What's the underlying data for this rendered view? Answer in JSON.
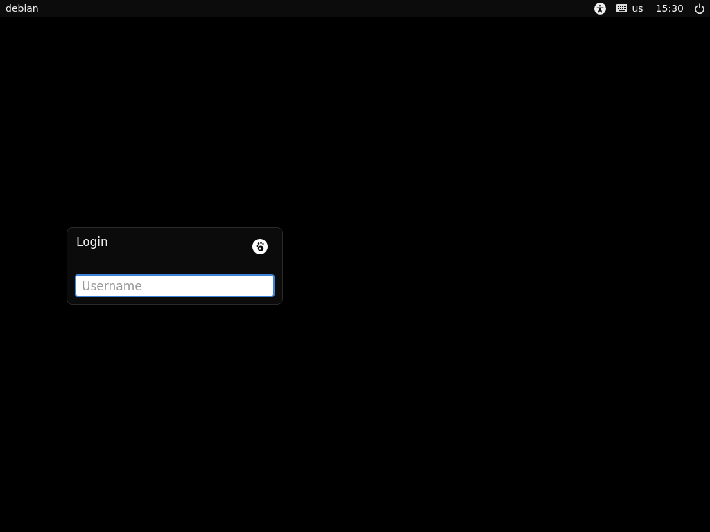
{
  "top_bar": {
    "hostname": "debian",
    "keyboard_layout": "us",
    "clock": "15:30"
  },
  "login_card": {
    "title": "Login",
    "username_field": {
      "placeholder": "Username",
      "focused": true
    }
  }
}
